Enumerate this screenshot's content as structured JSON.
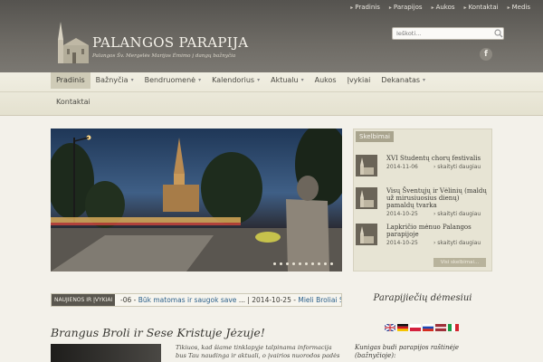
{
  "top_links": [
    "Pradinis",
    "Parapijos",
    "Aukos",
    "Kontaktai",
    "Medis"
  ],
  "site": {
    "title": "PALANGOS PARAPIJA",
    "subtitle": "Palangos Šv. Mergelės Marijos Ėmimo į dangų bažnyčia"
  },
  "search": {
    "placeholder": "Ieškoti..."
  },
  "icons": [
    "search-icon",
    "facebook-icon",
    "church-logo-icon",
    "chevron-down-icon"
  ],
  "nav": {
    "row1": [
      {
        "label": "Pradinis",
        "caret": false,
        "active": true
      },
      {
        "label": "Bažnyčia",
        "caret": true,
        "active": false
      },
      {
        "label": "Bendruomenė",
        "caret": true,
        "active": false
      },
      {
        "label": "Kalendorius",
        "caret": true,
        "active": false
      },
      {
        "label": "Aktualu",
        "caret": true,
        "active": false
      },
      {
        "label": "Aukos",
        "caret": false,
        "active": false
      },
      {
        "label": "Įvykiai",
        "caret": false,
        "active": false
      },
      {
        "label": "Dekanatas",
        "caret": true,
        "active": false
      }
    ],
    "row2": [
      {
        "label": "Kontaktai",
        "caret": false,
        "active": false
      }
    ]
  },
  "slider": {
    "dot_count": 10
  },
  "notices": {
    "title": "Skelbimai",
    "items": [
      {
        "title": "XVI Studentų chorų festivalis",
        "date": "2014-11-06",
        "more": "› skaityti daugiau"
      },
      {
        "title": "Visų Šventųjų ir Vėlinių (maldų už mirusiuosius dienų) pamaldų tvarka",
        "date": "2014-10-25",
        "more": "› skaityti daugiau"
      },
      {
        "title": "Lapkričio mėnuo Palangos parapijoje",
        "date": "2014-10-25",
        "more": "› skaityti daugiau"
      }
    ],
    "all_button": "Visi skelbimai..."
  },
  "ticker": {
    "label": "NAUJIENOS IR ĮVYKIAI",
    "lead": "-06 - ",
    "item1": "Būk matomas ir saugok save",
    "sep": " ... | 2014-10-25 - ",
    "item2": "Mieli Broliai Seser"
  },
  "welcome": {
    "heading": "Brangus Broli ir Sese Kristuje Jėzuje!",
    "text": "Tikiuos, kad šiame tinklapyje talpinama informacija bus Tau naudinga ir aktuali, o įvairios nuorodos padės"
  },
  "sidebar": {
    "title": "Parapijiečių dėmesiui",
    "flags": [
      "uk",
      "de",
      "pl",
      "ru",
      "lv",
      "it"
    ],
    "text": "Kunigas budi parapijos raštinėje (bažnyčioje):"
  }
}
